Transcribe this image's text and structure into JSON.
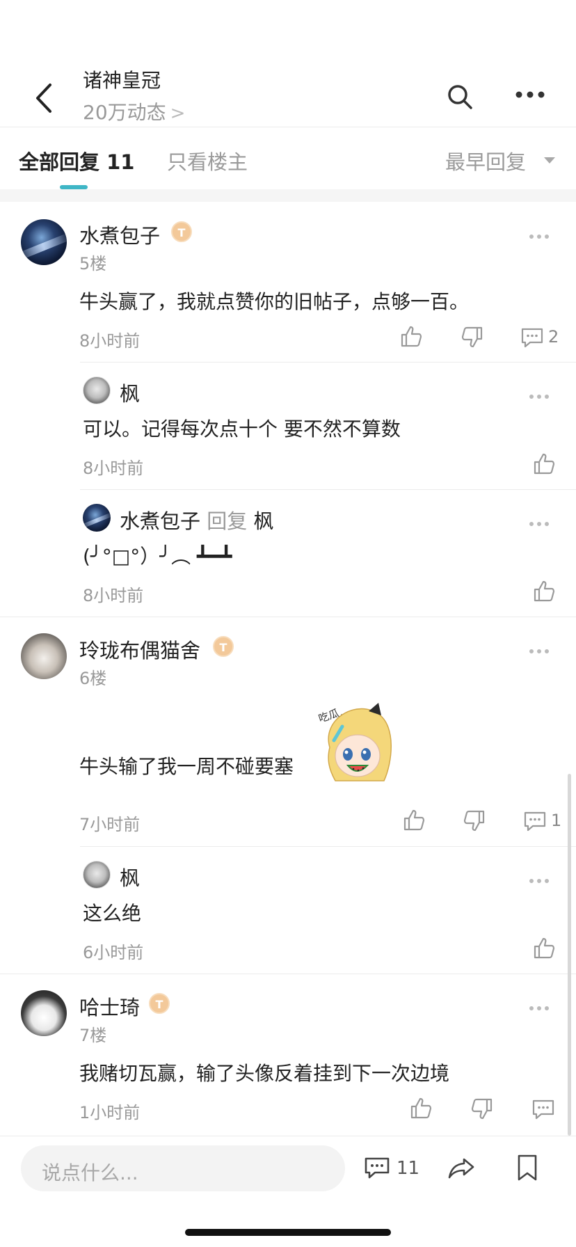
{
  "header": {
    "title": "诸神皇冠",
    "subtitle": "20万动态",
    "subtitle_chevron": ">"
  },
  "tabs": {
    "all_label": "全部回复 11",
    "op_only_label": "只看楼主",
    "sort_label": "最早回复"
  },
  "comments": [
    {
      "name": "水煮包子",
      "badge": "T",
      "floor": "5楼",
      "content": "牛头赢了，我就点赞你的旧帖子，点够一百。",
      "time": "8小时前",
      "reply_count": "2",
      "replies": [
        {
          "name": "枫",
          "content": "可以。记得每次点十个 要不然不算数",
          "time": "8小时前"
        },
        {
          "name": "水煮包子",
          "reply_word": "回复",
          "reply_to": "枫",
          "content": "(╯°□°）╯︵ ┻━┻",
          "time": "8小时前"
        }
      ]
    },
    {
      "name": "玲珑布偶猫舍",
      "badge": "T",
      "floor": "6楼",
      "content": "牛头输了我一周不碰要塞",
      "sticker_text": "吃瓜…",
      "time": "7小时前",
      "reply_count": "1",
      "replies": [
        {
          "name": "枫",
          "content": "这么绝",
          "time": "6小时前"
        }
      ]
    },
    {
      "name": "哈士琦",
      "badge": "T",
      "floor": "7楼",
      "content": "我赌切瓦赢，输了头像反着挂到下一次边境",
      "time": "1小时前"
    }
  ],
  "bottom_bar": {
    "input_placeholder": "说点什么...",
    "comment_count": "11"
  },
  "colors": {
    "accent": "#3fb6c6",
    "badge": "#f3c99a",
    "text": "#222222",
    "muted": "#999999"
  }
}
